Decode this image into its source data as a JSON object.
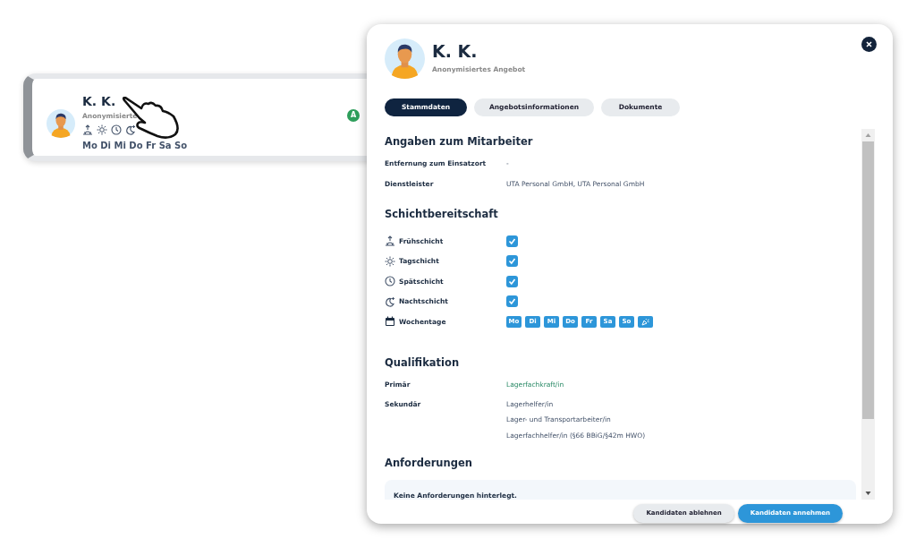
{
  "background_card": {
    "name": "K. K.",
    "subtitle": "Anonymisierte",
    "days": "Mo Di Mi Do Fr Sa So",
    "badge": "A"
  },
  "modal": {
    "name": "K. K.",
    "subtitle": "Anonymisiertes Angebot",
    "tabs": [
      {
        "label": "Stammdaten",
        "selected": true
      },
      {
        "label": "Angebotsinformationen",
        "selected": false
      },
      {
        "label": "Dokumente",
        "selected": false
      }
    ],
    "employee": {
      "title": "Angaben zum Mitarbeiter",
      "fields": [
        {
          "label": "Entfernung zum Einsatzort",
          "value": "-"
        },
        {
          "label": "Dienstleister",
          "value": "UTA Personal GmbH, UTA Personal GmbH"
        }
      ]
    },
    "shifts": {
      "title": "Schichtbereitschaft",
      "items": [
        {
          "kind": "sunrise",
          "label": "Frühschicht",
          "checked": true
        },
        {
          "kind": "sun",
          "label": "Tagschicht",
          "checked": true
        },
        {
          "kind": "clock",
          "label": "Spätschicht",
          "checked": true
        },
        {
          "kind": "moon",
          "label": "Nachtschicht",
          "checked": true
        }
      ],
      "weekdays": {
        "label": "Wochentage",
        "days": [
          {
            "kind": "day",
            "label": "Mo",
            "selected": true
          },
          {
            "kind": "day",
            "label": "Di",
            "selected": true
          },
          {
            "kind": "day",
            "label": "Mi",
            "selected": true
          },
          {
            "kind": "day",
            "label": "Do",
            "selected": true
          },
          {
            "kind": "day",
            "label": "Fr",
            "selected": true
          },
          {
            "kind": "day",
            "label": "Sa",
            "selected": true
          },
          {
            "kind": "day",
            "label": "So",
            "selected": true
          },
          {
            "kind": "holiday",
            "selected": true
          }
        ]
      }
    },
    "qualification": {
      "title": "Qualifikation",
      "primary_label": "Primär",
      "primary": "Lagerfachkraft/in",
      "secondary_label": "Sekundär",
      "secondary": [
        "Lagerhelfer/in",
        "Lager- und Transportarbeiter/in",
        "Lagerfachhelfer/in (§66 BBiG/§42m HWO)"
      ]
    },
    "requirements": {
      "title": "Anforderungen",
      "note": "Keine Anforderungen hinterlegt."
    },
    "buttons": [
      {
        "kind": "secondary",
        "label": "Kandidaten ablehnen"
      },
      {
        "kind": "primary",
        "label": "Kandidaten annehmen"
      }
    ]
  }
}
